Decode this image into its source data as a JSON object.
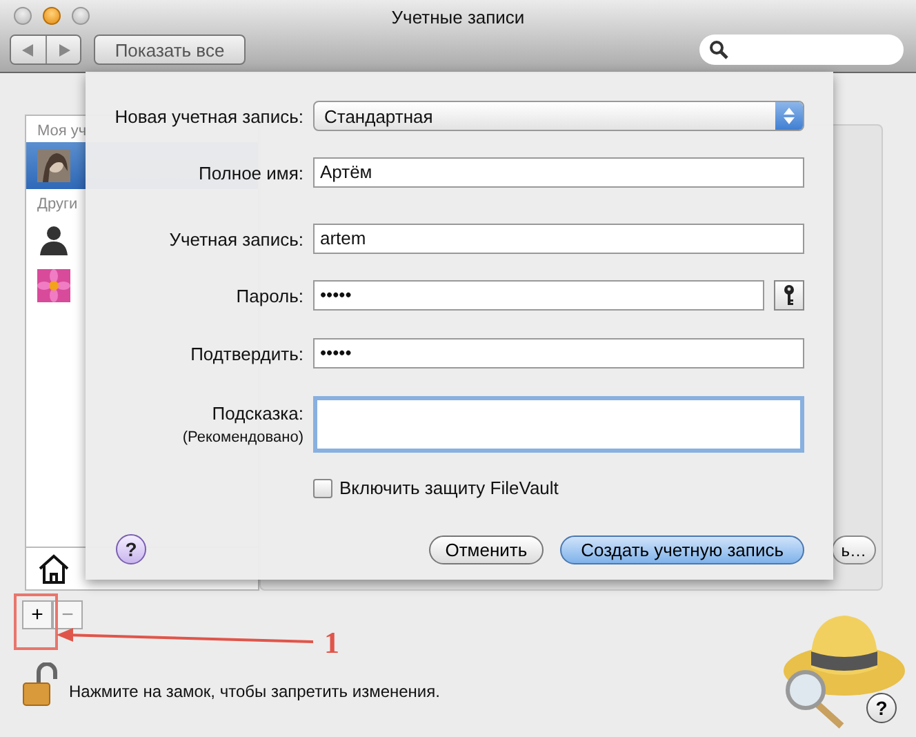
{
  "window": {
    "title": "Учетные записи"
  },
  "toolbar": {
    "show_all": "Показать все"
  },
  "sidebar": {
    "sections": [
      {
        "label": "Моя уч",
        "items": [
          {
            "kind": "photo",
            "selected": true
          }
        ]
      },
      {
        "label": "Други",
        "items": [
          {
            "kind": "silhouette",
            "selected": false
          },
          {
            "kind": "flower",
            "selected": false
          }
        ]
      }
    ]
  },
  "background_button": "ь…",
  "sheet": {
    "fields": [
      {
        "kind": "popup",
        "label": "Новая учетная запись:",
        "value": "Стандартная"
      },
      {
        "kind": "text",
        "label": "Полное имя:",
        "value": "Артём"
      },
      {
        "kind": "text",
        "label": "Учетная запись:",
        "value": "artem"
      },
      {
        "kind": "password",
        "label": "Пароль:",
        "value": "•••••",
        "key_button": true
      },
      {
        "kind": "password",
        "label": "Подтвердить:",
        "value": "•••••"
      },
      {
        "kind": "textarea",
        "label": "Подсказка:",
        "sublabel": "(Рекомендовано)",
        "focused": true
      }
    ],
    "filevault": {
      "label": "Включить защиту FileVault",
      "checked": false
    },
    "help": "?",
    "buttons": [
      {
        "label": "Отменить",
        "default": false
      },
      {
        "label": "Создать учетную запись",
        "default": true
      }
    ]
  },
  "account_buttons": [
    "+",
    "−"
  ],
  "lock": {
    "locked": false,
    "message": "Нажмите на замок, чтобы запретить изменения."
  },
  "help": "?",
  "annotation": {
    "label": "1"
  }
}
